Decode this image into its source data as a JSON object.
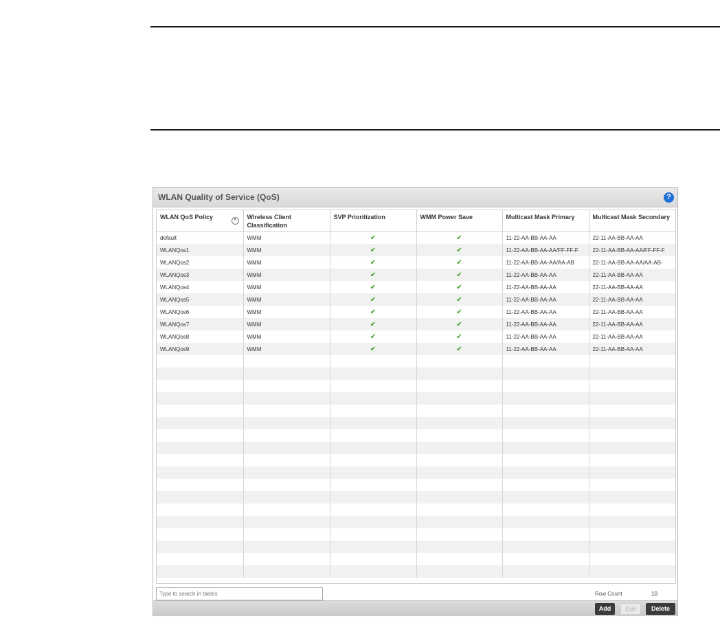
{
  "panel": {
    "title": "WLAN Quality of Service (QoS)",
    "help_icon": "?"
  },
  "columns": [
    "WLAN QoS Policy",
    "Wireless Client Classification",
    "SVP Prioritization",
    "WMM Power Save",
    "Multicast Mask Primary",
    "Multicast Mask Secondary"
  ],
  "rows": [
    {
      "policy": "default",
      "classification": "WMM",
      "svp": "✔",
      "wmm_ps": "✔",
      "mask_primary": "11-22-AA-BB-AA-AA",
      "mask_secondary": "22-11-AA-BB-AA-AA"
    },
    {
      "policy": "WLANQos1",
      "classification": "WMM",
      "svp": "✔",
      "wmm_ps": "✔",
      "mask_primary": "11-22-AA-BB-AA-AA/FF-FF-F",
      "mask_secondary": "22-11-AA-BB-AA-AA/FF-FF-F"
    },
    {
      "policy": "WLANQos2",
      "classification": "WMM",
      "svp": "✔",
      "wmm_ps": "✔",
      "mask_primary": "11-22-AA-BB-AA-AA/AA-AB",
      "mask_secondary": "22-11-AA-BB-AA-AA/AA-AB-"
    },
    {
      "policy": "WLANQos3",
      "classification": "WMM",
      "svp": "✔",
      "wmm_ps": "✔",
      "mask_primary": "11-22-AA-BB-AA-AA",
      "mask_secondary": "22-11-AA-BB-AA-AA"
    },
    {
      "policy": "WLANQos4",
      "classification": "WMM",
      "svp": "✔",
      "wmm_ps": "✔",
      "mask_primary": "11-22-AA-BB-AA-AA",
      "mask_secondary": "22-11-AA-BB-AA-AA"
    },
    {
      "policy": "WLANQos5",
      "classification": "WMM",
      "svp": "✔",
      "wmm_ps": "✔",
      "mask_primary": "11-22-AA-BB-AA-AA",
      "mask_secondary": "22-11-AA-BB-AA-AA"
    },
    {
      "policy": "WLANQos6",
      "classification": "WMM",
      "svp": "✔",
      "wmm_ps": "✔",
      "mask_primary": "11-22-AA-BB-AA-AA",
      "mask_secondary": "22-11-AA-BB-AA-AA"
    },
    {
      "policy": "WLANQos7",
      "classification": "WMM",
      "svp": "✔",
      "wmm_ps": "✔",
      "mask_primary": "11-22-AA-BB-AA-AA",
      "mask_secondary": "22-11-AA-BB-AA-AA"
    },
    {
      "policy": "WLANQos8",
      "classification": "WMM",
      "svp": "✔",
      "wmm_ps": "✔",
      "mask_primary": "11-22-AA-BB-AA-AA",
      "mask_secondary": "22-11-AA-BB-AA-AA"
    },
    {
      "policy": "WLANQos9",
      "classification": "WMM",
      "svp": "✔",
      "wmm_ps": "✔",
      "mask_primary": "11-22-AA-BB-AA-AA",
      "mask_secondary": "22-11-AA-BB-AA-AA"
    }
  ],
  "search": {
    "placeholder": "Type to search in tables"
  },
  "row_count": {
    "label": "Row Count",
    "value": "10"
  },
  "buttons": {
    "add": "Add",
    "edit": "Edit",
    "delete": "Delete"
  },
  "colors": {
    "check": "#3c9a28",
    "help": "#1e6fd6",
    "button_dark": "#3b3b3b"
  }
}
